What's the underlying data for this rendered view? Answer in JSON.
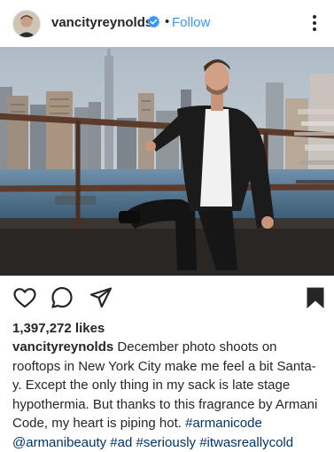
{
  "post": {
    "username": "vancityreynolds",
    "follow_separator": "•",
    "follow_label": "Follow",
    "likes": "1,397,272 likes",
    "caption": {
      "username": "vancityreynolds",
      "text": "December photo shoots on rooftops in New York City make me feel a bit Santa-y. Except the only thing in my sack is late stage hypothermia. But thanks to this fragrance by Armani Code, my heart is piping hot.",
      "tags": [
        "#armanicode",
        "@armanibeauty",
        "#ad",
        "#seriously",
        "#itwasreallycold"
      ]
    }
  },
  "icons": {
    "verified": "verified-badge-icon",
    "more": "more-options-icon",
    "like": "heart-icon",
    "comment": "comment-bubble-icon",
    "share": "paper-plane-icon",
    "save": "bookmark-icon"
  },
  "colors": {
    "link_blue": "#3897f0",
    "hashtag": "#003569",
    "text": "#262626"
  }
}
